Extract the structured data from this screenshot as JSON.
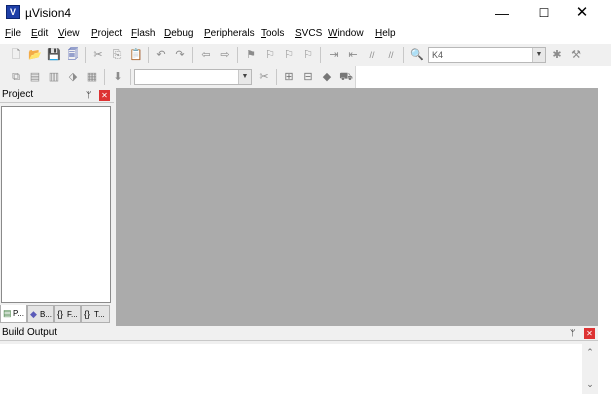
{
  "window": {
    "title": "µVision4",
    "app_icon_glyph": "V",
    "min_glyph": "—",
    "max_glyph": "☐",
    "close_glyph": "✕"
  },
  "menu": [
    "File",
    "Edit",
    "View",
    "Project",
    "Flash",
    "Debug",
    "Peripherals",
    "Tools",
    "SVCS",
    "Window",
    "Help"
  ],
  "toolbar1": {
    "buttons": [
      {
        "name": "new-file-icon",
        "glyph": "🗋"
      },
      {
        "name": "open-folder-icon",
        "glyph": "📂"
      },
      {
        "name": "save-icon",
        "glyph": "💾"
      },
      {
        "name": "save-all-icon",
        "glyph": "🗐"
      },
      {
        "name": "cut-icon",
        "glyph": "✂"
      },
      {
        "name": "copy-icon",
        "glyph": "⎘"
      },
      {
        "name": "paste-icon",
        "glyph": "📋"
      },
      {
        "name": "undo-icon",
        "glyph": "↶"
      },
      {
        "name": "redo-icon",
        "glyph": "↷"
      },
      {
        "name": "navigate-back-icon",
        "glyph": "⇦"
      },
      {
        "name": "navigate-forward-icon",
        "glyph": "⇨"
      },
      {
        "name": "bookmark-insert-icon",
        "glyph": "⚑"
      },
      {
        "name": "bookmark-prev-icon",
        "glyph": "⚐"
      },
      {
        "name": "bookmark-next-icon",
        "glyph": "⚐"
      },
      {
        "name": "bookmark-clear-icon",
        "glyph": "⚐"
      },
      {
        "name": "indent-icon",
        "glyph": "⇥"
      },
      {
        "name": "unindent-icon",
        "glyph": "⇤"
      },
      {
        "name": "comment-icon",
        "glyph": "//"
      },
      {
        "name": "uncomment-icon",
        "glyph": "//"
      },
      {
        "name": "find-in-files-icon",
        "glyph": "🔍"
      },
      {
        "name": "debug-session-icon",
        "glyph": "✱"
      },
      {
        "name": "configure-icon",
        "glyph": "⚒"
      }
    ],
    "find_combo_value": "K4",
    "combo_arrow": "▼"
  },
  "toolbar2": {
    "buttons": [
      {
        "name": "translate-icon",
        "glyph": "⧉"
      },
      {
        "name": "build-icon",
        "glyph": "▤"
      },
      {
        "name": "rebuild-icon",
        "glyph": "▥"
      },
      {
        "name": "batch-build-icon",
        "glyph": "⬗"
      },
      {
        "name": "stop-build-icon",
        "glyph": "▦"
      },
      {
        "name": "download-icon",
        "glyph": "⬇"
      },
      {
        "name": "target-options-icon",
        "glyph": "✂"
      },
      {
        "name": "file-extensions-icon",
        "glyph": "⊞"
      },
      {
        "name": "manage-components-icon",
        "glyph": "⊟"
      },
      {
        "name": "select-device-icon",
        "glyph": "◆"
      },
      {
        "name": "packs-icon",
        "glyph": "⛟"
      }
    ],
    "combo_arrow": "▼"
  },
  "project_panel": {
    "title": "Project",
    "pin_glyph": "ᛘ",
    "close_glyph": "✕",
    "tabs": [
      {
        "icon": "▤",
        "label": "P..."
      },
      {
        "icon": "◆",
        "label": "B..."
      },
      {
        "icon": "{}",
        "label": "F..."
      },
      {
        "icon": "{}",
        "label": "T..."
      }
    ]
  },
  "build_panel": {
    "title": "Build Output",
    "pin_glyph": "ᛘ",
    "close_glyph": "✕",
    "scroll_up": "⌃",
    "scroll_down": "⌄"
  }
}
